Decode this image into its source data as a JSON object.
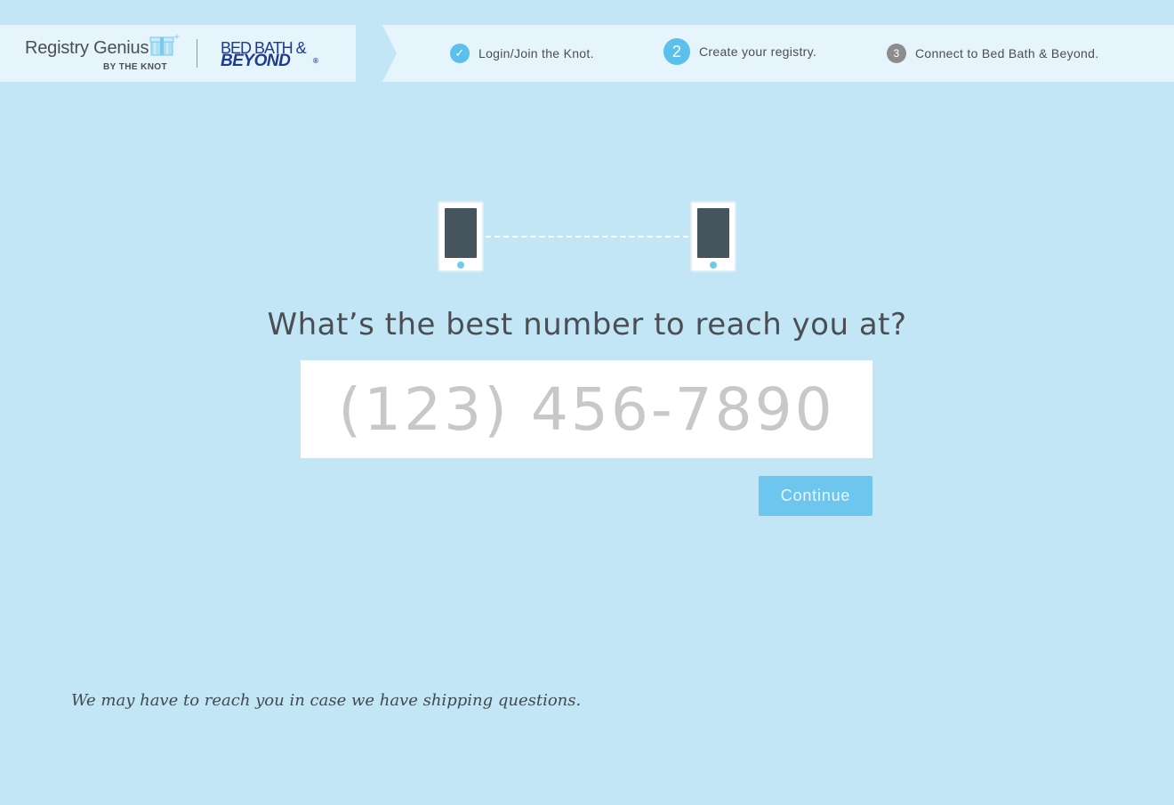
{
  "brand": {
    "registry_name": "Registry Genius",
    "registry_sub": "BY THE KNOT",
    "partner_line1": "BED BATH &",
    "partner_line2": "BEYOND",
    "partner_reg": "®",
    "partner_color": "#1f3a93"
  },
  "steps": [
    {
      "badge": "✓",
      "label": "Login/Join the Knot.",
      "state": "done"
    },
    {
      "badge": "2",
      "label": "Create your registry.",
      "state": "current"
    },
    {
      "badge": "3",
      "label": "Connect to Bed Bath & Beyond.",
      "state": "todo"
    }
  ],
  "form": {
    "question": "What’s the best number to reach you at?",
    "phone_placeholder": "(123) 456-7890",
    "phone_value": "",
    "continue_label": "Continue"
  },
  "footnote": "We may have to reach you in case we have shipping questions.",
  "colors": {
    "background": "#c3e6f7",
    "header": "#e6f4fb",
    "accent": "#5bc0ec",
    "button": "#6ec6ef",
    "todo_badge": "#8d8d8d"
  },
  "icons": {
    "gift": "gift-box-icon",
    "check": "checkmark-icon",
    "phone": "smartphone-icon"
  }
}
